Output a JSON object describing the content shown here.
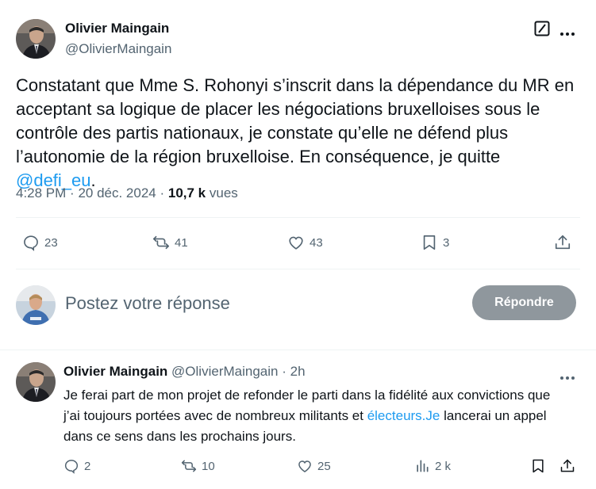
{
  "main_tweet": {
    "author_name": "Olivier Maingain",
    "author_handle": "@OlivierMaingain",
    "text_before_link": "Constatant que Mme S. Rohonyi s’inscrit dans la dépendance du MR en acceptant sa logique de placer les négociations bruxelloises sous le contrôle des partis nationaux, je constate qu’elle ne défend plus l’autonomie de la région bruxelloise. En conséquence, je quitte ",
    "link_text": "@defi_eu",
    "text_after_link": ".",
    "time": "4:28 PM",
    "date": "20 déc. 2024",
    "views_count": "10,7 k",
    "views_label": "vues",
    "replies": "23",
    "reposts": "41",
    "likes": "43",
    "bookmarks": "3"
  },
  "reply_box": {
    "placeholder": "Postez votre réponse",
    "button_label": "Répondre"
  },
  "reply_tweet": {
    "author_name": "Olivier Maingain",
    "author_handle": "@OlivierMaingain",
    "time_ago": "2h",
    "text_before_link": "Je ferai part de mon projet de refonder le parti dans la fidélité aux convictions que j’ai toujours portées avec de nombreux militants et ",
    "link_text": "électeurs.Je",
    "text_after_link": " lancerai un appel dans ce sens dans les prochains jours.",
    "replies": "2",
    "reposts": "10",
    "likes": "25",
    "views": "2 k"
  },
  "colors": {
    "link": "#1d9bf0",
    "secondary_text": "#536471",
    "reply_button": "#8f979d"
  }
}
